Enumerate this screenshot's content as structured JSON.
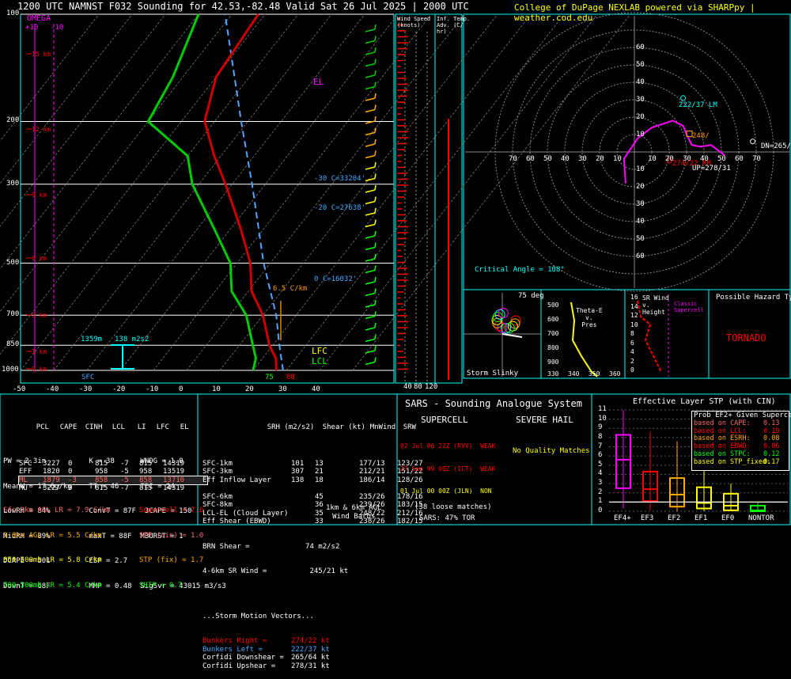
{
  "header": {
    "left": "1200 UTC NAMNST F032 Sounding for 42.53,-82.48 Valid  Sat 26 Jul 2025 | 2000 UTC",
    "right": "College of DuPage NEXLAB powered via SHARPpy | weather.cod.edu"
  },
  "colors": {
    "temp": "#cc0000",
    "dew": "#00cc00",
    "parcel": "#4da6ff",
    "wetbulb": "#00cccc",
    "isotherm": "#888888",
    "background": "#000000"
  },
  "chart_data": [
    {
      "type": "skewt",
      "pressure_ticks": [
        "100",
        "200",
        "300",
        "500",
        "700",
        "850",
        "1000"
      ],
      "temp_ticks": [
        "-50",
        "-40",
        "-30",
        "-20",
        "-10",
        "0",
        "10",
        "20",
        "30",
        "40"
      ],
      "height_labels": [
        "15 km",
        "12 km",
        "9 km",
        "6 km",
        "3 km",
        "1 km",
        "0 km"
      ],
      "omega_labels": [
        "OMEGA",
        "+10",
        "-10"
      ],
      "profile_temp": [
        {
          "p": 1000,
          "t": 27
        },
        {
          "p": 925,
          "t": 24
        },
        {
          "p": 850,
          "t": 19
        },
        {
          "p": 700,
          "t": 10
        },
        {
          "p": 600,
          "t": 1
        },
        {
          "p": 500,
          "t": -6
        },
        {
          "p": 400,
          "t": -17
        },
        {
          "p": 300,
          "t": -32
        },
        {
          "p": 250,
          "t": -42
        },
        {
          "p": 200,
          "t": -53
        },
        {
          "p": 150,
          "t": -60
        },
        {
          "p": 100,
          "t": -62
        }
      ],
      "profile_dew": [
        {
          "p": 1000,
          "t": 20
        },
        {
          "p": 925,
          "t": 18
        },
        {
          "p": 850,
          "t": 14
        },
        {
          "p": 700,
          "t": 5
        },
        {
          "p": 600,
          "t": -5
        },
        {
          "p": 500,
          "t": -12
        },
        {
          "p": 400,
          "t": -25
        },
        {
          "p": 300,
          "t": -42
        },
        {
          "p": 250,
          "t": -50
        },
        {
          "p": 200,
          "t": -70
        },
        {
          "p": 150,
          "t": -73
        },
        {
          "p": 100,
          "t": -80
        }
      ],
      "profile_parcel": [
        {
          "p": 1000,
          "t": 29
        },
        {
          "p": 850,
          "t": 22
        },
        {
          "p": 700,
          "t": 14
        },
        {
          "p": 500,
          "t": -2
        },
        {
          "p": 300,
          "t": -24
        },
        {
          "p": 200,
          "t": -42
        },
        {
          "p": 100,
          "t": -72
        }
      ],
      "annotations": {
        "el": "EL",
        "lfc": "LFC",
        "lcl": "LCL",
        "c1": "-30 C=33204'",
        "c2": "-20 C=27638'",
        "c3": "0 C=16032'",
        "lapse": "6.5 C/km",
        "inflow_base": "1359m",
        "inflow_srh": "138 m2s2",
        "sfc": "SFC",
        "sfc_t": "75",
        "sfc_td": "88"
      }
    },
    {
      "type": "hodograph",
      "ticks": [
        "10",
        "20",
        "30",
        "40",
        "50",
        "60",
        "70"
      ],
      "yticks": [
        "60",
        "50",
        "40",
        "30",
        "20",
        "10",
        "10",
        "20",
        "30",
        "40",
        "50",
        "60"
      ],
      "labels": {
        "lm": "222/37 LM",
        "rm": "274/22 RM",
        "up": "UP=278/31",
        "dn": "DN=265/",
        "mw": "248/",
        "crit": "Critical Angle = 108°"
      }
    },
    {
      "type": "table",
      "title": "Effective Layer STP (with CIN)",
      "categories": [
        "EF4+",
        "EF3",
        "EF2",
        "EF1",
        "EF0",
        "NONTOR"
      ],
      "yticks": [
        "11",
        "10",
        "9",
        "8",
        "7",
        "6",
        "5",
        "4",
        "3",
        "2",
        "1",
        "0"
      ],
      "box_medians": [
        5.6,
        2.4,
        1.8,
        0.9,
        0.6,
        0.1
      ],
      "box_q1": [
        2.5,
        1.1,
        0.5,
        0.3,
        0.1,
        0.0
      ],
      "box_q3": [
        8.3,
        4.3,
        3.6,
        2.6,
        1.9,
        0.6
      ],
      "box_min": [
        0.3,
        0.1,
        0.0,
        0.0,
        0.0,
        0.0
      ],
      "box_max": [
        11.0,
        8.6,
        7.6,
        5.5,
        3.0,
        1.0
      ]
    }
  ],
  "wind_panel": {
    "title": "Wind Speed\n(knots)",
    "ticks": [
      "40",
      "80",
      "120"
    ]
  },
  "inftemp_panel": {
    "title": "Inf. Temp.\nAdv. (C/\nhr)"
  },
  "slinky": {
    "title": "Storm Slinky",
    "deg": "75 deg"
  },
  "thetae": {
    "title": "Theta-E\nv.\nPres",
    "xticks": [
      "330",
      "340",
      "350",
      "360"
    ],
    "yticks": [
      "500",
      "600",
      "700",
      "800",
      "900"
    ]
  },
  "srwind": {
    "title": "SR Wind\nv.\nHeight",
    "sub": "Classic\nSupercell",
    "yticks": [
      "16",
      "14",
      "12",
      "10",
      "8",
      "6",
      "4",
      "2",
      "0"
    ]
  },
  "hazard": {
    "title": "Possible Hazard Type",
    "value": "TORNADO"
  },
  "thermo": {
    "head": [
      "PCL",
      "CAPE",
      "CINH",
      "LCL",
      "LI",
      "LFC",
      "EL"
    ],
    "rows": [
      [
        "SFC",
        "3227",
        "0",
        "815",
        "-7",
        "815",
        "14319"
      ],
      [
        "EFF",
        "1820",
        "0",
        "958",
        "-5",
        "958",
        "13519"
      ],
      [
        "ML",
        "1879",
        "-3",
        "858",
        "-5",
        "858",
        "13710"
      ],
      [
        "MU",
        "3227",
        "0",
        "815",
        "-7",
        "815",
        "14319"
      ]
    ],
    "params": [
      "PW = 2.3in          K = 38      WNDG = 1.0",
      "MeanW = 17.6g/kg    TT = 46     TEI = 24",
      "LowRH = 84%         ConvT = 87F  3CAPE = 150",
      "MidRH = 89%         maxT = 88F  MBURST = 1",
      "DCAPE = 501         ESP = 2.7",
      "DownT = 68F         MMP = 0.48  SigSvr = 43015 m3/s3"
    ],
    "lapse": [
      "Sfc-3km AGL LR = 7.9 C/km",
      "3-6km AGL LR = 5.5 C/km",
      "850-500mb LR = 5.8 C/km",
      "700-500mb LR = 5.4 C/km"
    ],
    "composites": [
      "Supercell = 7.6",
      "STP (cin) = 1.0",
      "STP (fix) = 1.7",
      "SHIP = 0.7"
    ]
  },
  "kinematic": {
    "head": [
      "SRH (m2/s2)",
      "Shear (kt)",
      "MnWind",
      "SRW"
    ],
    "rows": [
      [
        "SFC-1km",
        "101",
        "13",
        "177/13",
        "123/27"
      ],
      [
        "SFC-3km",
        "307",
        "21",
        "212/21",
        "151/22"
      ],
      [
        "Eff Inflow Layer",
        "138",
        "18",
        "186/14",
        "128/26"
      ],
      [
        "",
        "",
        " ",
        "",
        ""
      ],
      [
        "SFC-6km",
        "",
        "45",
        "235/26",
        "178/16"
      ],
      [
        "SFC-8km",
        "",
        "36",
        "239/26",
        "183/15"
      ],
      [
        "LCL-EL (Cloud Layer)",
        "",
        "35",
        "248/22",
        "212/16"
      ],
      [
        "Eff Shear (EBWD)",
        "",
        "33",
        "238/26",
        "182/15"
      ]
    ],
    "brn": "BRN Shear =             74 m2/s2",
    "srwind": "4-6km SR Wind =          245/21 kt",
    "vectors_title": "...Storm Motion Vectors...",
    "vectors": [
      [
        "Bunkers Right =",
        "274/22 kt"
      ],
      [
        "Bunkers Left =",
        "222/37 kt"
      ],
      [
        "Corfidi Downshear =",
        "265/64 kt"
      ],
      [
        "Corfidi Upshear =",
        "278/31 kt"
      ]
    ],
    "barbs_note": "1km & 6km AGL\nWind Barbs"
  },
  "sars": {
    "title": "SARS - Sounding Analogue System",
    "supercell": "SUPERCELL",
    "hail": "SEVERE HAIL",
    "matches": [
      "02 Jul 06 22Z (RVV)  WEAK",
      "27 Sep 99 00Z (ICT)  WEAK",
      "01 Jul 00 00Z (JLN)  NON"
    ],
    "hail_note": "No Quality Matches",
    "loose": "(38 loose matches)",
    "tor": "SARS: 47% TOR"
  },
  "probs": {
    "title": "Prob EF2+ Given Supercell",
    "rows": [
      [
        "based on CAPE:",
        "0.13"
      ],
      [
        "based on LCL:",
        "0.19"
      ],
      [
        "based on ESRH:",
        "0.08"
      ],
      [
        "based on EBWD:",
        "0.06"
      ],
      [
        "based on STPC:",
        "0.12"
      ],
      [
        "based on STP_fixed:",
        "0.17"
      ]
    ]
  }
}
